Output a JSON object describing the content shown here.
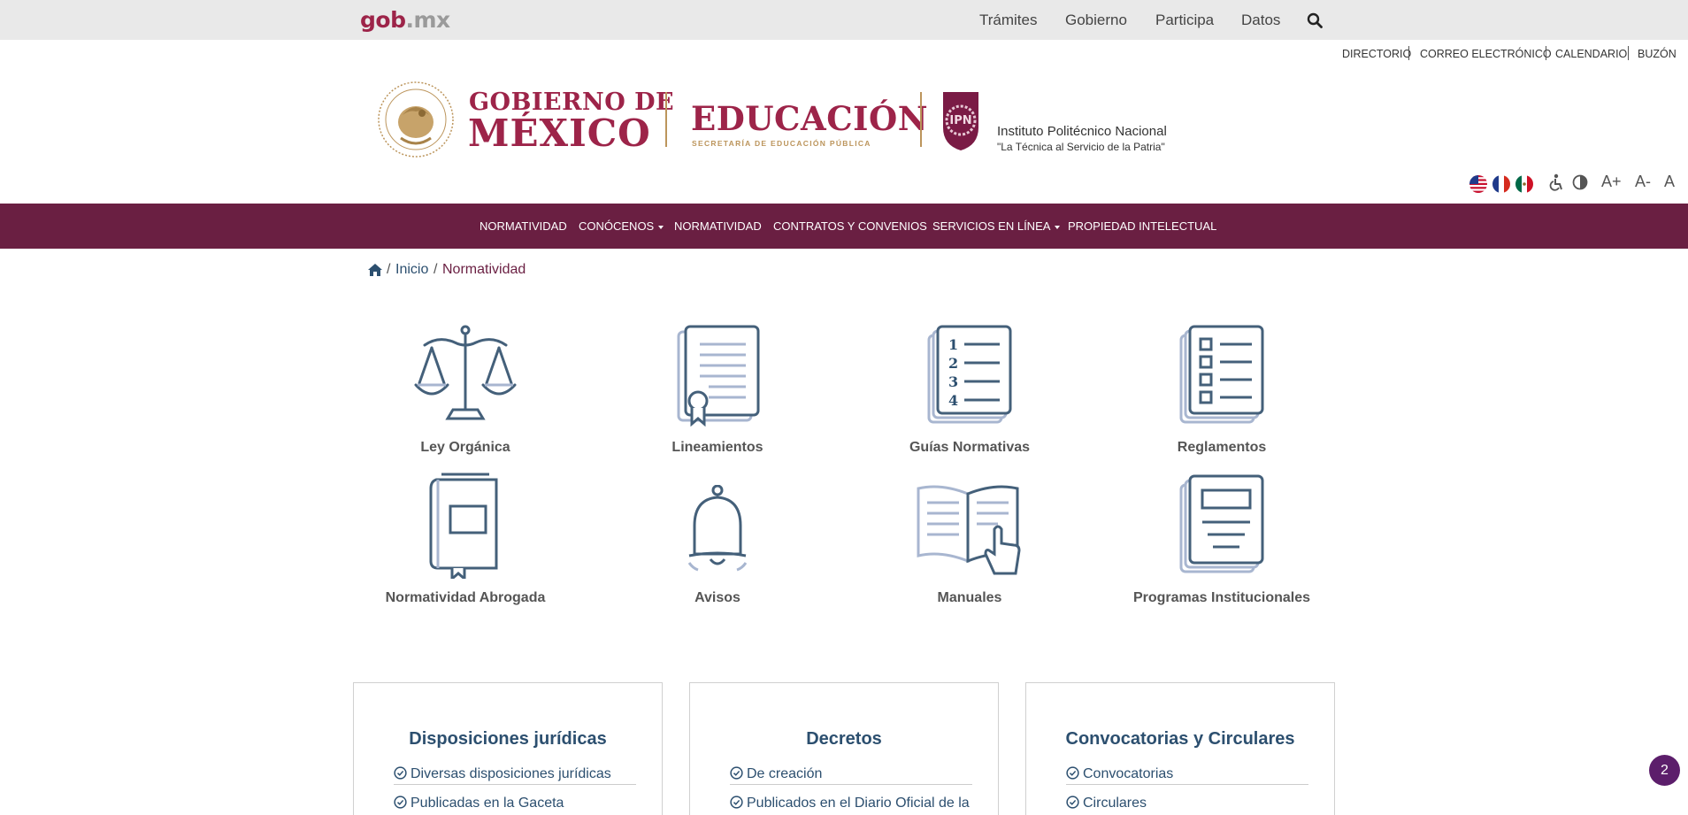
{
  "gobbar": {
    "logo_main": "gob",
    "logo_ext": ".mx",
    "nav": [
      "Trámites",
      "Gobierno",
      "Participa",
      "Datos"
    ]
  },
  "utility_links": [
    "DIRECTORIO",
    "CORREO ELECTRÓNICO",
    "CALENDARIO",
    "BUZÓN"
  ],
  "header": {
    "gob_line1": "GOBIERNO DE",
    "gob_line2": "MÉXICO",
    "educacion": "EDUCACIÓN",
    "sep_sub": "SECRETARÍA DE EDUCACIÓN PÚBLICA",
    "ipn_name": "Instituto Politécnico Nacional",
    "ipn_motto": "\"La Técnica al Servicio de la Patria\""
  },
  "accessibility": {
    "font_up": "A+",
    "font_down": "A-",
    "font_reset": "A"
  },
  "mainnav": [
    {
      "label": "NORMATIVIDAD",
      "dropdown": false
    },
    {
      "label": "CONÓCENOS",
      "dropdown": true
    },
    {
      "label": "NORMATIVIDAD",
      "dropdown": false
    },
    {
      "label": "CONTRATOS Y CONVENIOS",
      "dropdown": false
    },
    {
      "label": "SERVICIOS EN LÍNEA",
      "dropdown": true
    },
    {
      "label": "PROPIEDAD INTELECTUAL",
      "dropdown": false
    }
  ],
  "breadcrumb": {
    "home": "Inicio",
    "current": "Normatividad",
    "sep": "/"
  },
  "tiles": [
    {
      "label": "Ley Orgánica",
      "icon": "scales-icon"
    },
    {
      "label": "Lineamientos",
      "icon": "certificate-document-icon"
    },
    {
      "label": "Guías Normativas",
      "icon": "numbered-list-icon"
    },
    {
      "label": "Reglamentos",
      "icon": "checklist-icon"
    },
    {
      "label": "Normatividad Abrogada",
      "icon": "book-icon"
    },
    {
      "label": "Avisos",
      "icon": "bell-icon"
    },
    {
      "label": "Manuales",
      "icon": "open-book-hand-icon"
    },
    {
      "label": "Programas Institucionales",
      "icon": "document-stack-icon"
    }
  ],
  "cards": [
    {
      "title": "Disposiciones jurídicas",
      "links": [
        "Diversas disposiciones jurídicas",
        "Publicadas en la Gaceta"
      ]
    },
    {
      "title": "Decretos",
      "links": [
        "De creación",
        "Publicados en el Diario Oficial de la"
      ]
    },
    {
      "title": "Convocatorias y Circulares",
      "links": [
        "Convocatorias",
        "Circulares"
      ]
    }
  ],
  "badge": "2",
  "colors": {
    "guinda": "#9d2449",
    "nav_bg": "#6a1f42",
    "gold": "#bc955c",
    "link_blue": "#2c4f6f"
  }
}
